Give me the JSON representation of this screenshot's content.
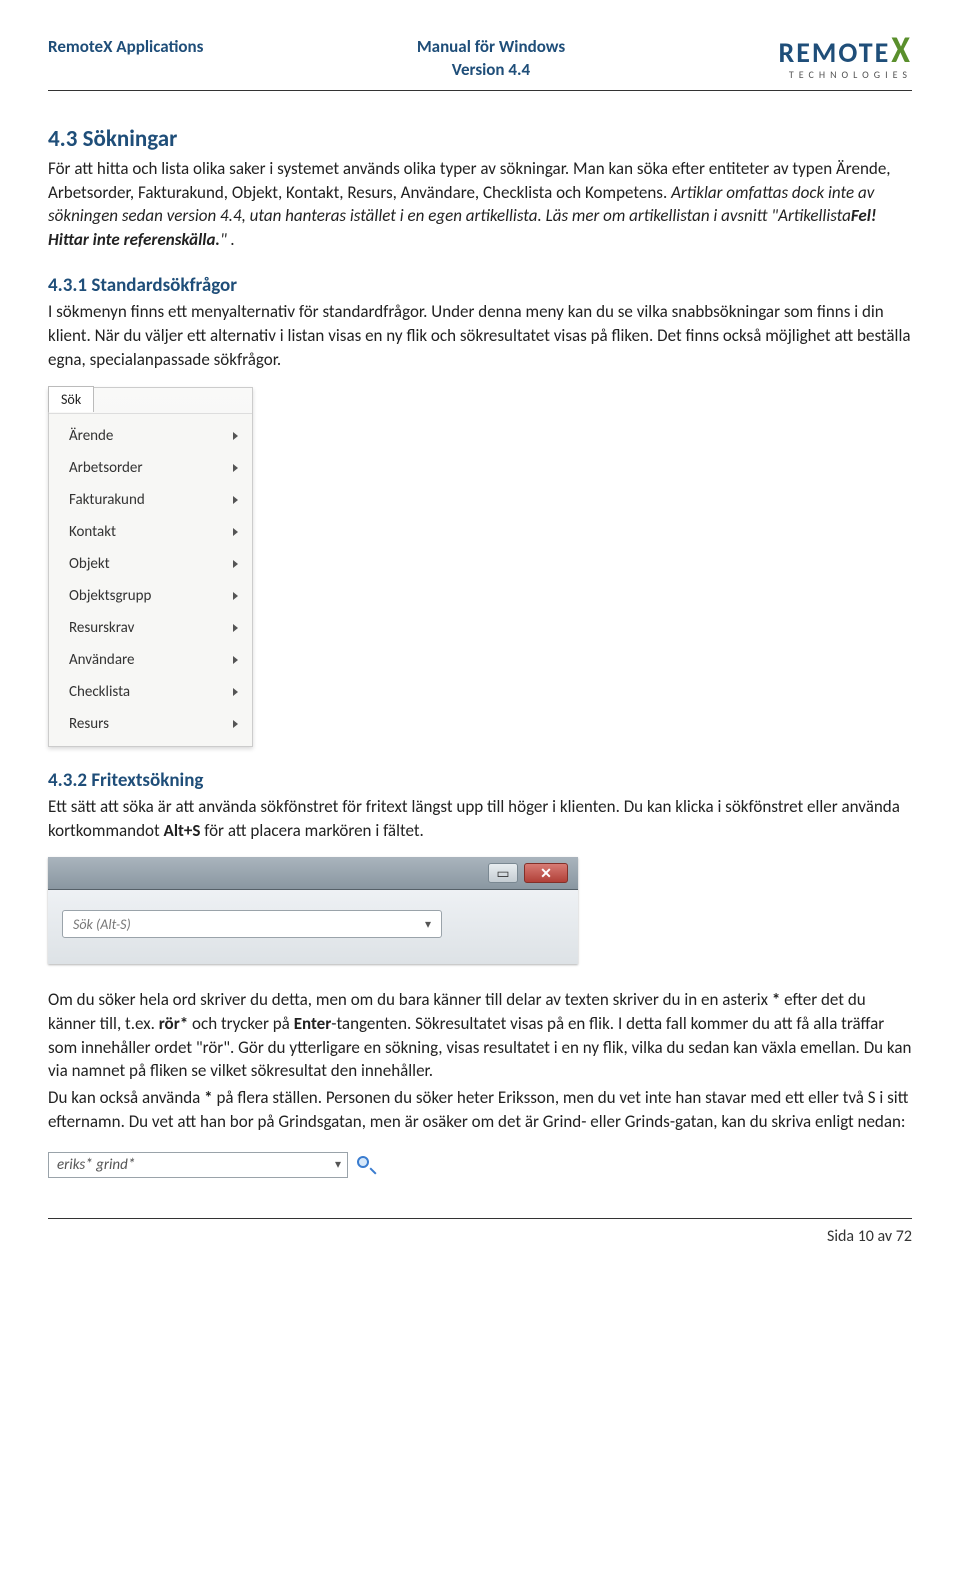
{
  "header": {
    "left": "RemoteX Applications",
    "center_line1": "Manual för Windows",
    "center_line2": "Version 4.4",
    "logo_main": "REMOTE",
    "logo_x": "X",
    "logo_sub": "TECHNOLOGIES"
  },
  "section43": {
    "num_title": "4.3   Sökningar",
    "p1a": "För att hitta och lista olika saker i systemet används olika typer av sökningar. Man kan söka efter entiteter av typen Ärende, Arbetsorder, Fakturakund, Objekt, Kontakt, Resurs, Användare, Checklista och Kompetens. ",
    "p1b_italic": "Artiklar omfattas dock inte av sökningen sedan version 4.4, utan hanteras istället i en egen artikellista. Läs mer om artikellistan i avsnitt \"Artikellista",
    "p1b_bold": "Fel! Hittar inte referenskälla.",
    "p1b_end": "\" ."
  },
  "section431": {
    "num_title": "4.3.1   Standardsökfrågor",
    "p1": "I sökmenyn finns ett menyalternativ för standardfrågor. Under denna meny kan du se vilka snabbsökningar som finns i din klient. När du väljer ett alternativ i listan visas en ny flik och sökresultatet visas på fliken. Det finns också möjlighet att beställa egna, specialanpassade sökfrågor."
  },
  "menu": {
    "tab": "Sök",
    "items": [
      "Ärende",
      "Arbetsorder",
      "Fakturakund",
      "Kontakt",
      "Objekt",
      "Objektsgrupp",
      "Resurskrav",
      "Användare",
      "Checklista",
      "Resurs"
    ]
  },
  "section432": {
    "num_title": "4.3.2   Fritextsökning",
    "p1a": "Ett sätt att söka är att använda sökfönstret för fritext längst upp till höger i klienten. Du kan klicka i sökfönstret eller använda kortkommandot ",
    "p1b_bold": "Alt+S",
    "p1c": " för att placera markören i fältet."
  },
  "searchbox": {
    "placeholder": "Sök  (Alt-S)"
  },
  "section432b": {
    "p2a": "Om du söker hela ord skriver du detta, men om du bara känner till delar av texten skriver du in en asterix ",
    "p2b_bold1": "*",
    "p2c": " efter det du känner till, t.ex. ",
    "p2d_bold2": "rör*",
    "p2e": " och trycker på ",
    "p2f_bold3": "Enter",
    "p2g": "-tangenten. Sökresultatet visas på en flik. I detta fall kommer du att få alla träffar som innehåller ordet \"rör\". Gör du ytterligare en sökning, visas resultatet i en ny flik, vilka du sedan kan växla emellan. Du kan via namnet på fliken se vilket sökresultat den innehåller.",
    "p3a": "Du kan också använda ",
    "p3b_bold": "*",
    "p3c": " på flera ställen. Personen du söker heter Eriksson, men du vet inte han stavar med ett eller två S i sitt efternamn. Du vet att han bor på Grindsgatan, men är osäker om det är Grind- eller Grinds-gatan, kan du skriva enligt nedan:"
  },
  "small_search": {
    "value": "eriks* grind*"
  },
  "footer": {
    "text": "Sida 10 av 72"
  }
}
